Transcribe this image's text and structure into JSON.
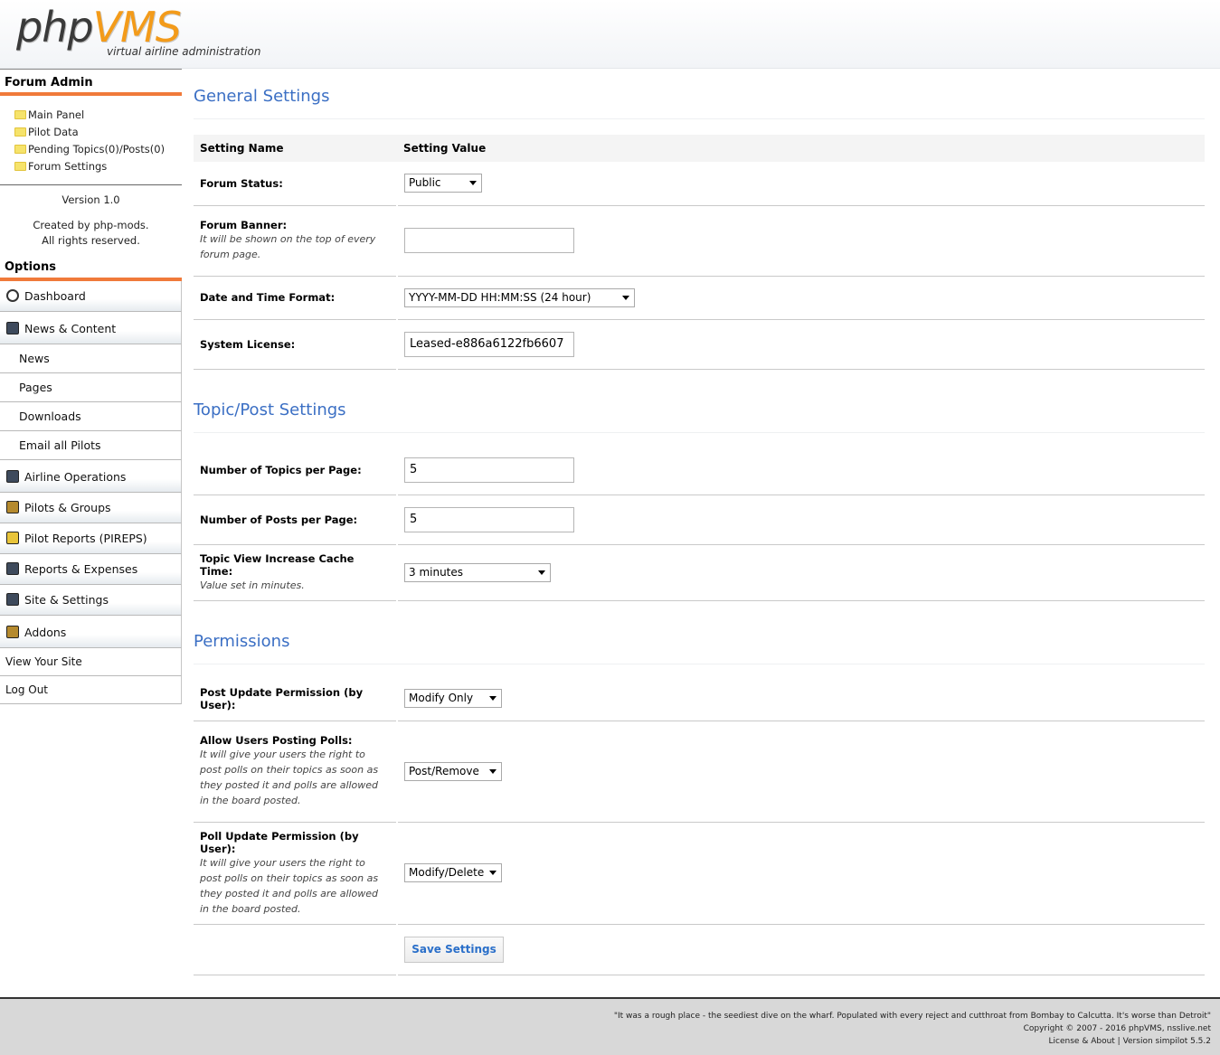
{
  "header": {
    "logo_php": "php",
    "logo_vms": "VMS",
    "logo_sub": "virtual airline administration"
  },
  "sidebar": {
    "forum_admin_heading": "Forum Admin",
    "forum_links": [
      "Main Panel",
      "Pilot Data",
      "Pending Topics(0)/Posts(0)",
      "Forum Settings"
    ],
    "version": "Version 1.0",
    "created_by_prefix": "Created by ",
    "created_by_link": "php-mods",
    "created_by_suffix": ".",
    "rights": "All rights reserved.",
    "options_heading": "Options",
    "menu": {
      "dashboard": "Dashboard",
      "news_content": "News & Content",
      "news": "News",
      "pages": "Pages",
      "downloads": "Downloads",
      "email_pilots": "Email all Pilots",
      "airline_ops": "Airline Operations",
      "pilots_groups": "Pilots & Groups",
      "pireps": "Pilot Reports (PIREPS)",
      "reports_expenses": "Reports & Expenses",
      "site_settings": "Site & Settings",
      "addons": "Addons",
      "view_site": "View Your Site",
      "logout": "Log Out"
    }
  },
  "general": {
    "title": "General Settings",
    "col_name": "Setting Name",
    "col_value": "Setting Value",
    "forum_status_label": "Forum Status:",
    "forum_status_value": "Public",
    "forum_banner_label": "Forum Banner:",
    "forum_banner_desc": "It will be shown on the top of every forum page.",
    "forum_banner_value": "",
    "date_format_label": "Date and Time Format:",
    "date_format_value": "YYYY-MM-DD HH:MM:SS (24 hour)",
    "license_label": "System License:",
    "license_value": "Leased-e886a6122fb6607"
  },
  "topic": {
    "title": "Topic/Post Settings",
    "topics_per_page_label": "Number of Topics per Page:",
    "topics_per_page_value": "5",
    "posts_per_page_label": "Number of Posts per Page:",
    "posts_per_page_value": "5",
    "cache_label": "Topic View Increase Cache Time:",
    "cache_desc": "Value set in minutes.",
    "cache_value": "3 minutes"
  },
  "permissions": {
    "title": "Permissions",
    "post_update_label": "Post Update Permission (by User):",
    "post_update_value": "Modify Only",
    "polls_label": "Allow Users Posting Polls:",
    "polls_desc": "It will give your users the right to post polls on their topics as soon as they posted it and polls are allowed in the board posted.",
    "polls_value": "Post/Remove",
    "poll_update_label": "Poll Update Permission (by User):",
    "poll_update_desc": "It will give your users the right to post polls on their topics as soon as they posted it and polls are allowed in the board posted.",
    "poll_update_value": "Modify/Delete",
    "save_label": "Save Settings"
  },
  "footer": {
    "quote": "\"It was a rough place - the seediest dive on the wharf. Populated with every reject and cutthroat from Bombay to Calcutta. It's worse than Detroit\"",
    "copyright": "Copyright © 2007 - 2016 phpVMS, nsslive.net",
    "license_line": "License & About | Version simpilot 5.5.2"
  }
}
